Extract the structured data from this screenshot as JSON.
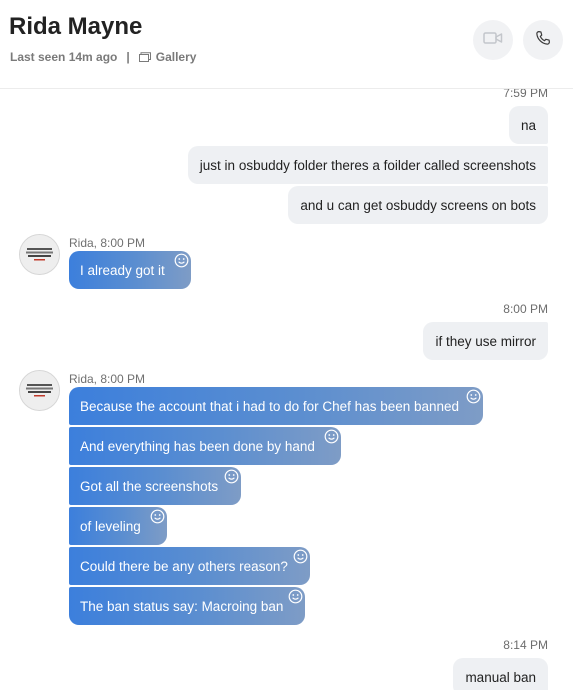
{
  "header": {
    "contact_name": "Rida Mayne",
    "last_seen": "Last seen 14m ago",
    "separator": "|",
    "gallery_label": "Gallery"
  },
  "colors": {
    "incoming_bubble_start": "#3c7fdc",
    "incoming_bubble_end": "#7e9cc6",
    "outgoing_bubble": "#eef0f3"
  },
  "icons": [
    "video-call-icon",
    "phone-call-icon",
    "gallery-icon",
    "add-reaction-icon"
  ],
  "messages": {
    "t1": "7:59 PM",
    "o1": "na",
    "o2": "just in osbuddy folder theres a foilder called screenshots",
    "o3": "and u can get osbuddy screens on bots",
    "m1": "Rida, 8:00 PM",
    "i1": "I already got it",
    "t2": "8:00 PM",
    "o4": "if they use mirror",
    "m2": "Rida, 8:00 PM",
    "i2": "Because the account that i had to do for Chef has been banned",
    "i3": "And everything has been done by hand",
    "i4": "Got all the screenshots",
    "i5": "of leveling",
    "i6": "Could there be any others reason?",
    "i7": "The ban status say: Macroing ban",
    "t3": "8:14 PM",
    "o5": "manual ban"
  }
}
